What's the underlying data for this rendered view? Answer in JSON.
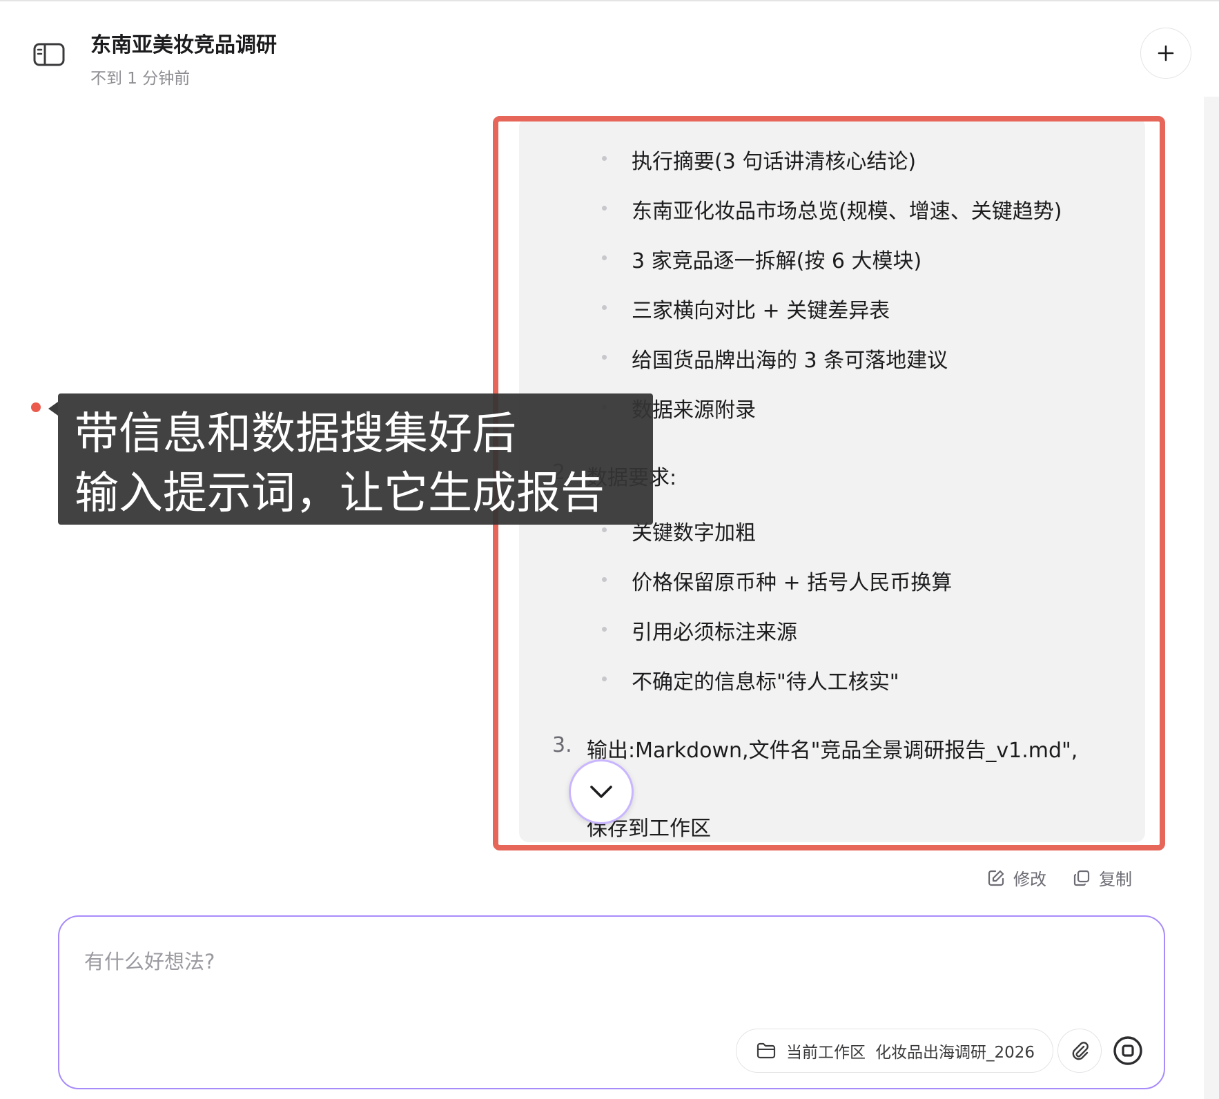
{
  "header": {
    "title": "东南亚美妆竞品调研",
    "subtitle": "不到 1 分钟前"
  },
  "message": {
    "bullets_a": [
      "执行摘要(3 句话讲清核心结论)",
      "东南亚化妆品市场总览(规模、增速、关键趋势)",
      "3 家竞品逐一拆解(按 6 大模块)",
      "三家横向对比 + 关键差异表",
      "给国货品牌出海的 3 条可落地建议",
      "数据来源附录"
    ],
    "item2_num": "2.",
    "item2_label": "数据要求:",
    "bullets_b": [
      "关键数字加粗",
      "价格保留原币种 + 括号人民币换算",
      "引用必须标注来源",
      "不确定的信息标\"待人工核实\""
    ],
    "item3_num": "3.",
    "item3_label": "输出:Markdown,文件名\"竞品全景调研报告_v1.md\",",
    "item3_cont": "保存到工作区"
  },
  "callout": {
    "line1": "带信息和数据搜集好后",
    "line2": "输入提示词，让它生成报告"
  },
  "actions": {
    "edit": "修改",
    "copy": "复制"
  },
  "composer": {
    "placeholder": "有什么好想法?",
    "workspace_label": "当前工作区",
    "workspace_name": "化妆品出海调研_2026"
  },
  "colors": {
    "highlight": "#e6665a",
    "composer_border": "#a78bfa",
    "bubble_bg": "#f2f2f2"
  },
  "icons": [
    "sidebar-toggle-icon",
    "plus-icon",
    "chevron-down-icon",
    "edit-icon",
    "copy-icon",
    "folder-icon",
    "paperclip-icon",
    "stop-icon"
  ]
}
